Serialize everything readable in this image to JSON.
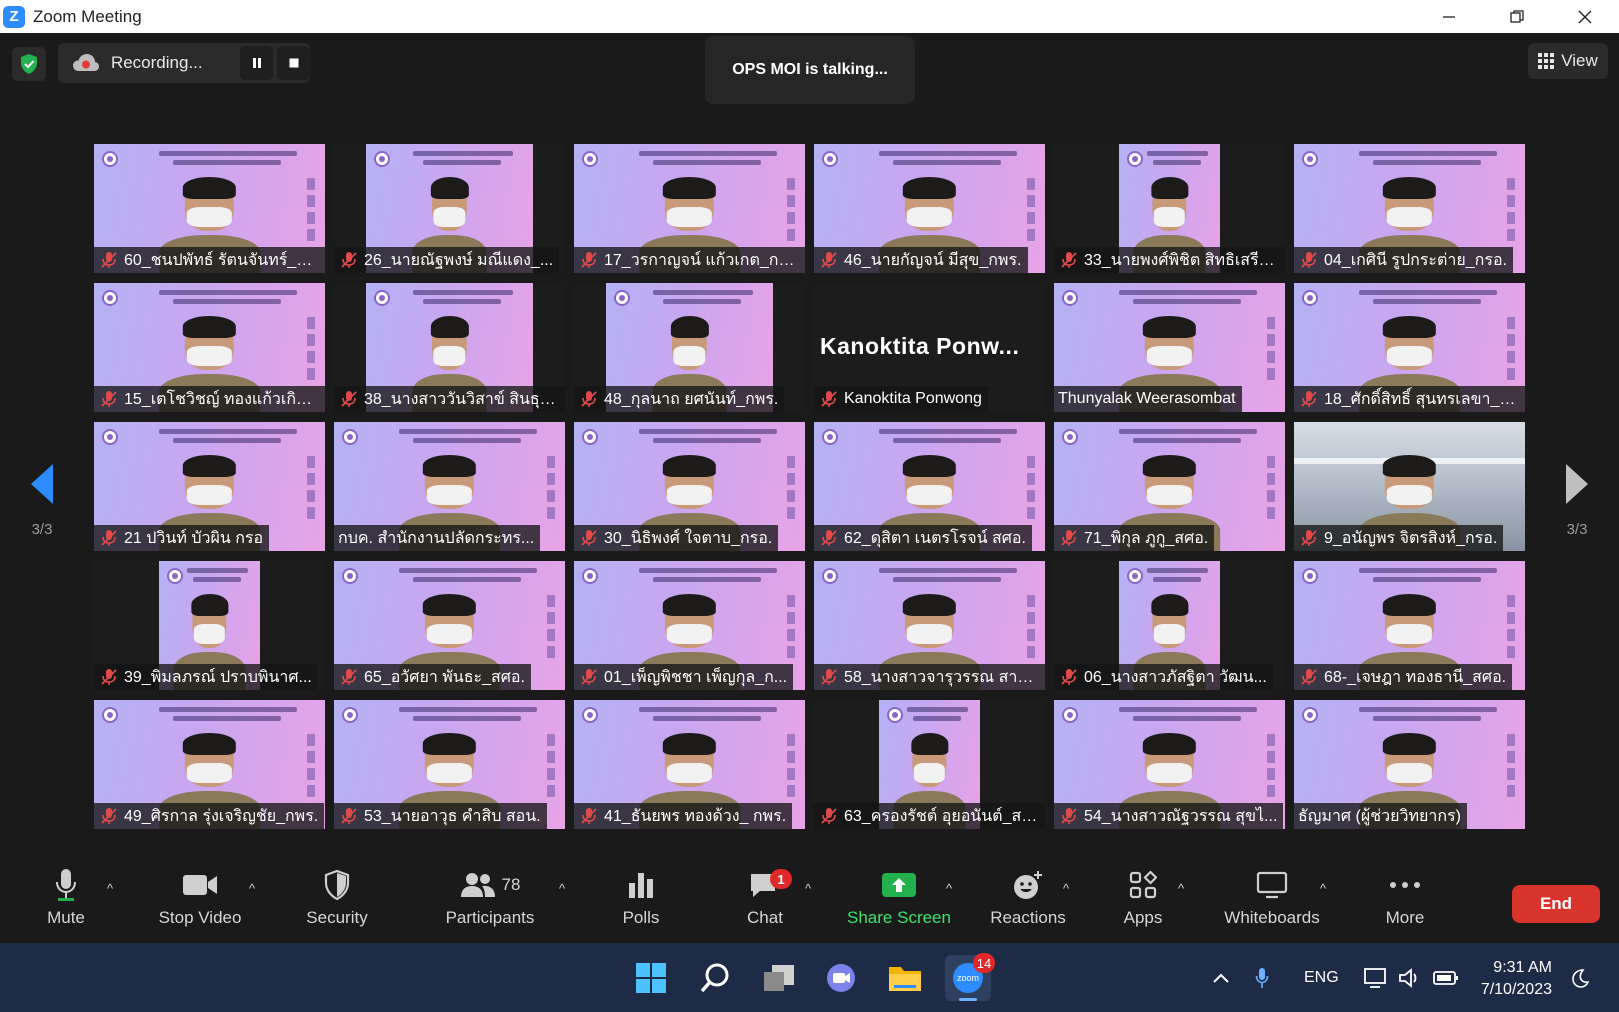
{
  "window": {
    "title": "Zoom Meeting",
    "minimize_icon": "minimize-icon",
    "restore_icon": "restore-icon",
    "close_icon": "close-icon"
  },
  "meeting_bar": {
    "recording_label": "Recording...",
    "talking_label": "OPS MOI is talking...",
    "view_label": "View"
  },
  "pagination": {
    "left_page": "3/3",
    "right_page": "3/3"
  },
  "colors": {
    "accent_green": "#3ee36b",
    "end_red": "#d9342b",
    "badge_red": "#e02828",
    "zoom_blue": "#2d8cff",
    "mic_off_red": "#e04a4a"
  },
  "participants": [
    {
      "name": "60_ชนปพัทธ์ รัตนจันทร์_ส...",
      "video": "slide",
      "muted": true
    },
    {
      "name": "26_นายณัฐพงษ์ มณีแดง_...",
      "video": "slide-crop",
      "muted": true
    },
    {
      "name": "17_วรกาญจน์ แก้วเกต_กร...",
      "video": "slide",
      "muted": true
    },
    {
      "name": "46_นายกัญจน์ มีสุข_กพร.",
      "video": "slide",
      "muted": true
    },
    {
      "name": "33_นายพงศ์พิชิต สิทธิเสรี_...",
      "video": "slide-narrow",
      "muted": true
    },
    {
      "name": "04_เกศินี รูปกระต่าย_กรอ.",
      "video": "slide",
      "muted": true
    },
    {
      "name": "15_เตโชวิชญ์ ทองแก้วเกิด...",
      "video": "slide",
      "muted": true
    },
    {
      "name": "38_นางสาววันวิสาข์ สินธุป...",
      "video": "slide-crop",
      "muted": true
    },
    {
      "name": "48_กุลนาถ  ยศนันท์_กพร.",
      "video": "slide-crop",
      "muted": true
    },
    {
      "name": "Kanoktita Ponwong",
      "video": "none",
      "big_name": "Kanoktita  Ponw...",
      "muted": true
    },
    {
      "name": "Thunyalak Weerasombat",
      "video": "slide",
      "muted": false
    },
    {
      "name": "18_ศักดิ์สิทธิ์ สุนทรเลขา_ก...",
      "video": "slide",
      "muted": true
    },
    {
      "name": "21 ปวินท์ บัวผิน กรอ",
      "video": "slide",
      "muted": true
    },
    {
      "name": "กบค. สำนักงานปลัดกระทร...",
      "video": "slide",
      "muted": false
    },
    {
      "name": "30_นิธิพงศ์ ใจตาบ_กรอ.",
      "video": "slide",
      "muted": true
    },
    {
      "name": "62_ดุสิตา เนตรโรจน์ สศอ.",
      "video": "slide",
      "muted": true
    },
    {
      "name": "71_พิกุล ภูกู_สศอ.",
      "video": "slide",
      "muted": true
    },
    {
      "name": "9_อนัญพร จิตรสิงห์_กรอ.",
      "video": "camera",
      "muted": true
    },
    {
      "name": "39_พิมลภรณ์ ปราบพินาศ...",
      "video": "slide-narrow",
      "muted": true
    },
    {
      "name": "65_อวัศยา พันธะ_สศอ.",
      "video": "slide",
      "muted": true
    },
    {
      "name": "01_เพ็ญพิชชา เพ็ญกุล_ก...",
      "video": "slide",
      "muted": true
    },
    {
      "name": "58_นางสาวจารุวรรณ สาย...",
      "video": "slide",
      "muted": true
    },
    {
      "name": "06_นางสาวภัสฐิตา วัฒน...",
      "video": "slide-narrow",
      "muted": true
    },
    {
      "name": "68-_เจษฎา ทองธานี_สศอ.",
      "video": "slide",
      "muted": true
    },
    {
      "name": "49_ศิรกาล รุ่งเจริญชัย_กพร.",
      "video": "slide",
      "muted": true
    },
    {
      "name": "53_นายอาวุธ  คำสิบ สอน.",
      "video": "slide",
      "muted": true
    },
    {
      "name": "41_ธันยพร ทองด้วง_ กพร.",
      "video": "slide",
      "muted": true
    },
    {
      "name": "63_ครองรัชต์ อุยอนันต์_สศ...",
      "video": "slide-narrow",
      "muted": true
    },
    {
      "name": "54_นางสาวณัฐวรรณ สุขไ...",
      "video": "slide",
      "muted": true
    },
    {
      "name": "ธัญมาศ (ผู้ช่วยวิทยากร)",
      "video": "slide",
      "muted": false
    }
  ],
  "toolbar": {
    "mute_label": "Mute",
    "stop_video_label": "Stop Video",
    "security_label": "Security",
    "participants_label": "Participants",
    "participants_count": "78",
    "polls_label": "Polls",
    "chat_label": "Chat",
    "chat_badge": "1",
    "share_screen_label": "Share Screen",
    "reactions_label": "Reactions",
    "apps_label": "Apps",
    "whiteboards_label": "Whiteboards",
    "more_label": "More",
    "end_label": "End"
  },
  "taskbar": {
    "zoom_badge": "14",
    "zoom_label": "zoom",
    "language": "ENG",
    "time": "9:31 AM",
    "date": "7/10/2023"
  }
}
